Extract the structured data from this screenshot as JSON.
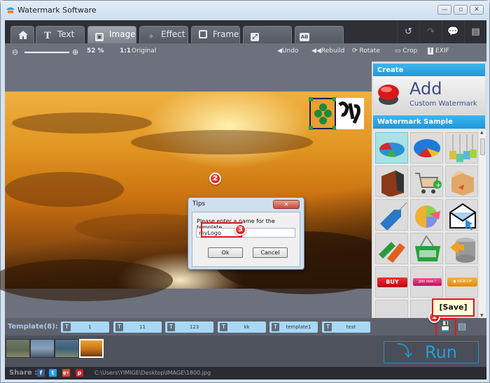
{
  "window": {
    "title": "Watermark Software",
    "controls": {
      "minimize": "—",
      "maximize": "▫",
      "close": "✕"
    }
  },
  "tabs": [
    {
      "label": "",
      "icon": "home-icon"
    },
    {
      "label": "Text",
      "icon": "text-icon"
    },
    {
      "label": "Image",
      "icon": "image-icon",
      "active": true
    },
    {
      "label": "Effect",
      "icon": "magic-wand-icon"
    },
    {
      "label": "Frame",
      "icon": "frame-icon"
    },
    {
      "label": "Resize",
      "icon": "resize-icon"
    },
    {
      "label": "Rename",
      "icon": "rename-icon"
    }
  ],
  "top_right_icons": [
    "undo-icon",
    "redo-icon",
    "feedback-icon",
    "document-icon"
  ],
  "toolbar": {
    "zoom_percent": "52 %",
    "original_ratio": "1:1",
    "original_label": "Original",
    "undo": "Undo",
    "rebuild": "Rebuild",
    "rotate": "Rotate",
    "crop": "Crop",
    "exif": "EXIF"
  },
  "dialog": {
    "title": "Tips",
    "close": "✕",
    "prompt": "Please enter a name for the template.",
    "input_value": "myLogo",
    "ok": "Ok",
    "cancel": "Cancel"
  },
  "badges": {
    "one": "1",
    "two": "2",
    "three": "3"
  },
  "right_panel": {
    "create_header": "Create",
    "add_title": "Add",
    "add_subtitle": "Custom Watermark",
    "sample_header": "Watermark Sample",
    "samples": [
      "pie-chart-3d",
      "pie-chart-blue",
      "sale-tags",
      "server-rack",
      "shopping-cart-add",
      "open-box",
      "price-tag",
      "pie-chart-pastel",
      "email-envelope",
      "sale-door-hangers",
      "shopping-basket",
      "database-arrow",
      "buy-button",
      "join-now-button",
      "sign-up-button"
    ],
    "sample_labels": {
      "buy": "BUY",
      "join": "Join now !",
      "signup": "● SIGN UP"
    }
  },
  "tooltip": "[Save]",
  "templates": {
    "label": "Template(8):",
    "items": [
      "1",
      "11",
      "123",
      "kk",
      "template1",
      "test"
    ]
  },
  "run_label": "Run",
  "share": {
    "label": "Share :",
    "networks": [
      "f",
      "t",
      "g+",
      "p"
    ],
    "file_path": "C:\\Users\\YIMIGE\\Desktop\\IMAGE\\1800.jpg"
  },
  "colors": {
    "accent": "#1f96d8",
    "highlight_red": "#e0141e",
    "template_chip": "#a8d8f8"
  }
}
